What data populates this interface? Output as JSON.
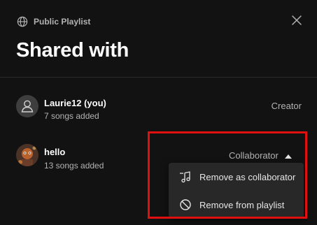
{
  "dialog": {
    "visibility_label": "Public Playlist",
    "title": "Shared with",
    "icons": {
      "visibility": "globe-icon",
      "close": "close-icon"
    }
  },
  "members": [
    {
      "name": "Laurie12 (you)",
      "songs": "7 songs added",
      "role": "Creator",
      "avatar": "person-icon"
    },
    {
      "name": "hello",
      "songs": "13 songs added",
      "role": "Collaborator",
      "avatar": "profile-photo",
      "role_icon": "caret-up-icon"
    }
  ],
  "role_menu": {
    "items": [
      {
        "label": "Remove as collaborator",
        "icon": "remove-collaborator-icon"
      },
      {
        "label": "Remove from playlist",
        "icon": "block-icon"
      }
    ]
  },
  "colors": {
    "background": "#121212",
    "menu": "#282828",
    "text_primary": "#ffffff",
    "text_secondary": "#b3b3b3",
    "highlight": "#e01010"
  }
}
